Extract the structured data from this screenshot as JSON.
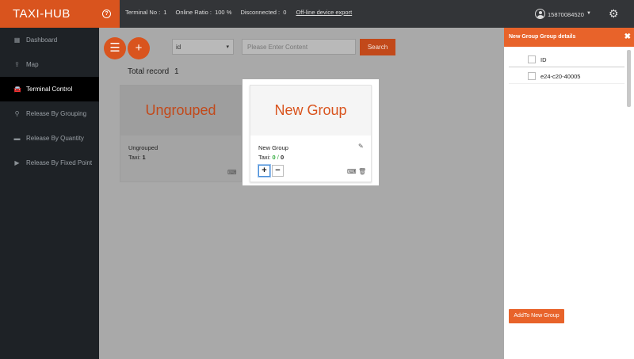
{
  "app": {
    "title": "TAXI-HUB"
  },
  "stats": {
    "terminal_no_label": "Terminal No :",
    "terminal_no_value": "1",
    "online_ratio_label": "Online Ratio :",
    "online_ratio_value": "100 %",
    "disconnected_label": "Disconnected :",
    "disconnected_value": "0",
    "export_link": "Off-line device export"
  },
  "user": {
    "name": "15870084520"
  },
  "sidebar": {
    "items": [
      {
        "label": "Dashboard",
        "icon": "dashboard-icon"
      },
      {
        "label": "Map",
        "icon": "map-icon"
      },
      {
        "label": "Terminal Control",
        "icon": "car-icon",
        "active": true
      },
      {
        "label": "Release By Grouping",
        "icon": "bicycle-icon"
      },
      {
        "label": "Release By Quantity",
        "icon": "list-icon"
      },
      {
        "label": "Release By Fixed Point",
        "icon": "play-icon"
      }
    ]
  },
  "toolbar": {
    "filter_value": "id",
    "search_placeholder": "Please Enter Content",
    "search_label": "Search"
  },
  "total": {
    "label": "Total record",
    "value": "1"
  },
  "groups": [
    {
      "title": "Ungrouped",
      "name": "Ungrouped",
      "taxi_label": "Taxi:",
      "taxi_value": "1"
    },
    {
      "title": "New Group",
      "name": "New Group",
      "taxi_label": "Taxi:",
      "online": "0",
      "sep": " / ",
      "total": "0",
      "plus": "+",
      "minus": "−"
    }
  ],
  "panel": {
    "title": "New Group Group details",
    "close": "✖",
    "column": "ID",
    "rows": [
      "e24-c20-40005"
    ],
    "add_label": "AddTo New Group"
  },
  "colors": {
    "accent": "#d9541e",
    "topbar": "#333538",
    "sidebar": "#1e2226",
    "online": "#2eaa3a"
  }
}
